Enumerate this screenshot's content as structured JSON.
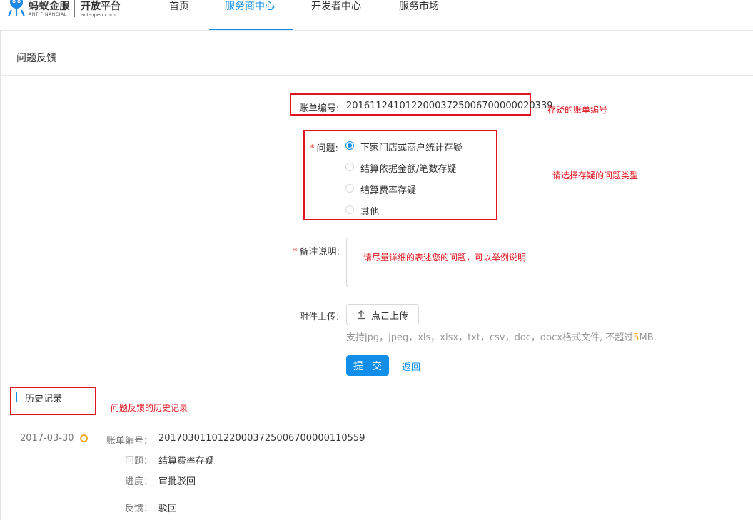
{
  "header": {
    "brand_cn": "蚂蚁金服",
    "brand_en": "ANT FINANCIAL",
    "platform_cn": "开放平台",
    "platform_url": "ant-open.com",
    "nav": [
      {
        "label": "首页"
      },
      {
        "label": "服务商中心",
        "active": true
      },
      {
        "label": "开发者中心"
      },
      {
        "label": "服务市场"
      }
    ]
  },
  "page": {
    "title": "问题反馈"
  },
  "form": {
    "bill": {
      "label": "账单编号:",
      "value": "20161124101220003725006700000020339"
    },
    "question": {
      "required": "*",
      "label": "问题:",
      "options": [
        {
          "label": "下家门店或商户统计存疑",
          "checked": true
        },
        {
          "label": "结算依据金额/笔数存疑",
          "checked": false
        },
        {
          "label": "结算费率存疑",
          "checked": false
        },
        {
          "label": "其他",
          "checked": false
        }
      ]
    },
    "remark": {
      "required": "*",
      "label": "备注说明:"
    },
    "attachment": {
      "label": "附件上传:",
      "button": "点击上传",
      "hint_before": "支持jpg，jpeg，xls，xlsx，txt，csv，doc，docx格式文件, 不超过",
      "hint_highlight": "5",
      "hint_after": "MB."
    },
    "submit": "提 交",
    "back": "返回"
  },
  "annotations": {
    "bill": "存疑的账单编号",
    "question": "请选择存疑的问题类型",
    "remark": "请尽量详细的表述您的问题，可以举例说明",
    "history": "问题反馈的历史记录"
  },
  "history": {
    "title": "历史记录",
    "items": [
      {
        "date": "2017-03-30",
        "bill_label": "账单编号：",
        "bill_value": "20170301101220003725006700000110559",
        "question_label": "问题：",
        "question_value": "结算费率存疑",
        "progress_label": "进度：",
        "progress_value": "审批驳回",
        "feedback_label": "反馈：",
        "feedback_value": "驳回"
      }
    ]
  },
  "colors": {
    "primary": "#108ee9",
    "annotation_red": "#e0141e",
    "required": "#f04134",
    "timeline_dot": "#f5a623"
  },
  "icons": [
    "ant-logo-icon",
    "upload-icon",
    "radio-icon"
  ]
}
